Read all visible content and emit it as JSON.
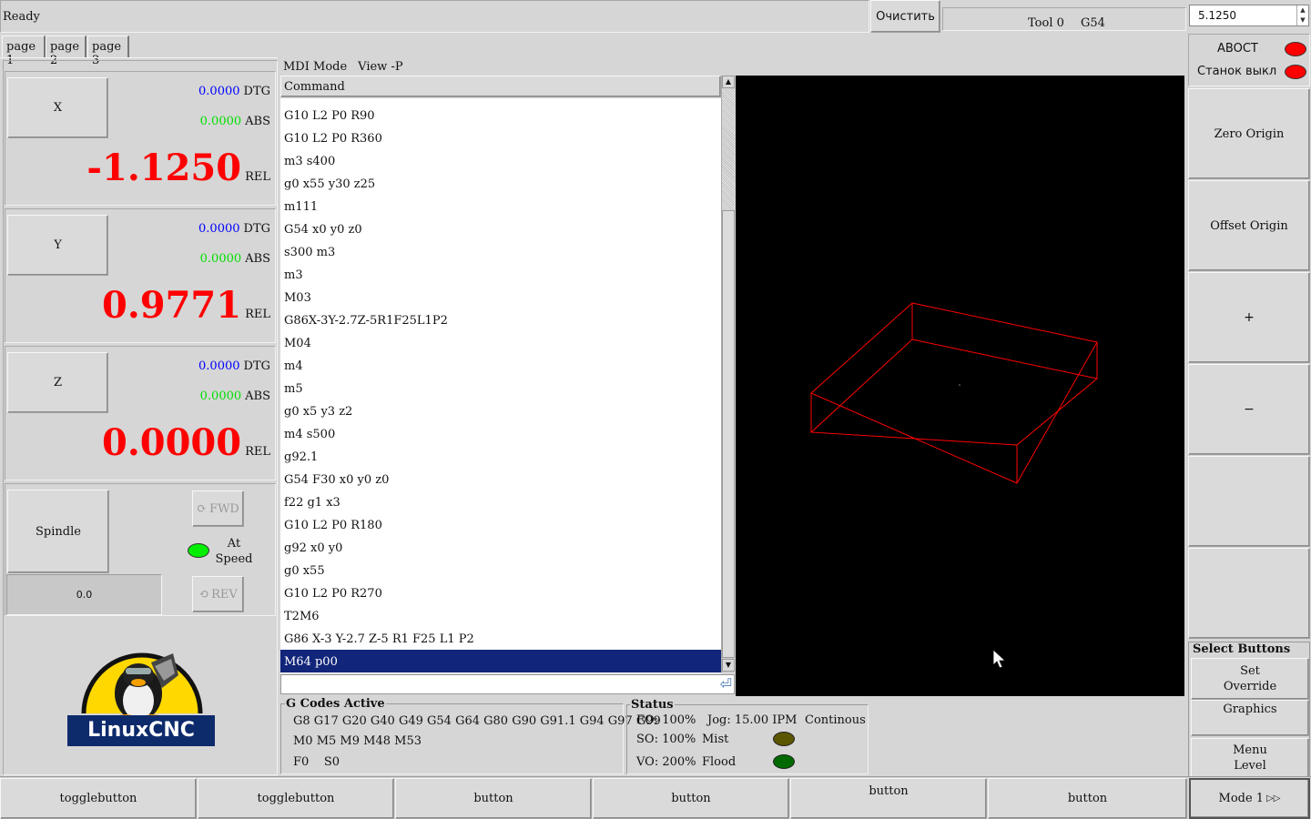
{
  "topbar": {
    "status": "Ready",
    "clear_label": "Очистить",
    "tool": "Tool 0",
    "coord_system": "G54",
    "jog_increment": "5.1250"
  },
  "tabs": [
    {
      "label": "page 1"
    },
    {
      "label": "page 2"
    },
    {
      "label": "page 3"
    }
  ],
  "dro": {
    "axes": [
      {
        "name": "X",
        "dtg": "0.0000",
        "abs": "0.0000",
        "rel": "-1.1250"
      },
      {
        "name": "Y",
        "dtg": "0.0000",
        "abs": "0.0000",
        "rel": "0.9771"
      },
      {
        "name": "Z",
        "dtg": "0.0000",
        "abs": "0.0000",
        "rel": "0.0000"
      }
    ],
    "dtg_label": "DTG",
    "abs_label": "ABS",
    "rel_label": "REL"
  },
  "spindle": {
    "label": "Spindle",
    "fwd": "FWD",
    "rev": "REV",
    "at_speed_1": "At",
    "at_speed_2": "Speed",
    "speed": "0.0"
  },
  "logo": {
    "text": "LinuxCNC"
  },
  "mdi": {
    "mode": "MDI Mode",
    "view": "View -P",
    "header": "Command",
    "commands": [
      "G10 L2 P0 R90",
      "G10 L2 P0 R360",
      "m3 s400",
      "g0 x55 y30 z25",
      "m111",
      "G54 x0 y0 z0",
      "s300 m3",
      "m3",
      "M03",
      "G86X-3Y-2.7Z-5R1F25L1P2",
      "M04",
      "m4",
      "m5",
      "g0 x5 y3 z2",
      "m4 s500",
      "g92.1",
      "G54 F30 x0 y0 z0",
      "f22 g1 x3",
      "G10 L2 P0 R180",
      "g92 x0 y0",
      "g0 x55",
      "G10 L2 P0 R270",
      "T2M6",
      "G86 X-3 Y-2.7 Z-5 R1 F25 L1 P2",
      "M64 p00"
    ],
    "entry_value": ""
  },
  "gcodes": {
    "title": "G Codes Active",
    "line1": "G8 G17 G20 G40 G49 G54 G64 G80 G90 G91.1 G94 G97 G99",
    "line2": "M0 M5 M9 M48 M53",
    "line3": "F0    S0"
  },
  "status": {
    "title": "Status",
    "fo": "FO: 100%",
    "so": "SO: 100%",
    "vo": "VO: 200%",
    "jog": "Jog: 15.00 IPM",
    "jog_mode": "Continous",
    "mist": "Mist",
    "flood": "Flood"
  },
  "right": {
    "estop_label": "ABOCT",
    "machine_label": "Станок выкл",
    "zero_origin": "Zero Origin",
    "offset_origin": "Offset Origin",
    "plus": "+",
    "minus": "−",
    "select_title": "Select Buttons",
    "set_override_1": "Set",
    "set_override_2": "Override",
    "graphics": "Graphics",
    "menu_level_1": "Menu",
    "menu_level_2": "Level",
    "mode": "Mode 1"
  },
  "bottom": [
    {
      "label": "togglebutton"
    },
    {
      "label": "togglebutton"
    },
    {
      "label": "button"
    },
    {
      "label": "button"
    },
    {
      "label": "button"
    },
    {
      "label": "button"
    }
  ],
  "colors": {
    "dro_rel": "#ff0000",
    "dro_dtg": "#0000ff",
    "dro_abs": "#00e000",
    "selection": "#11257a",
    "estop_led": "#ff0000",
    "at_speed_led": "#00ee00",
    "mist_led": "#5b5600",
    "flood_led": "#006a00",
    "preview_box": "#ff0000"
  }
}
